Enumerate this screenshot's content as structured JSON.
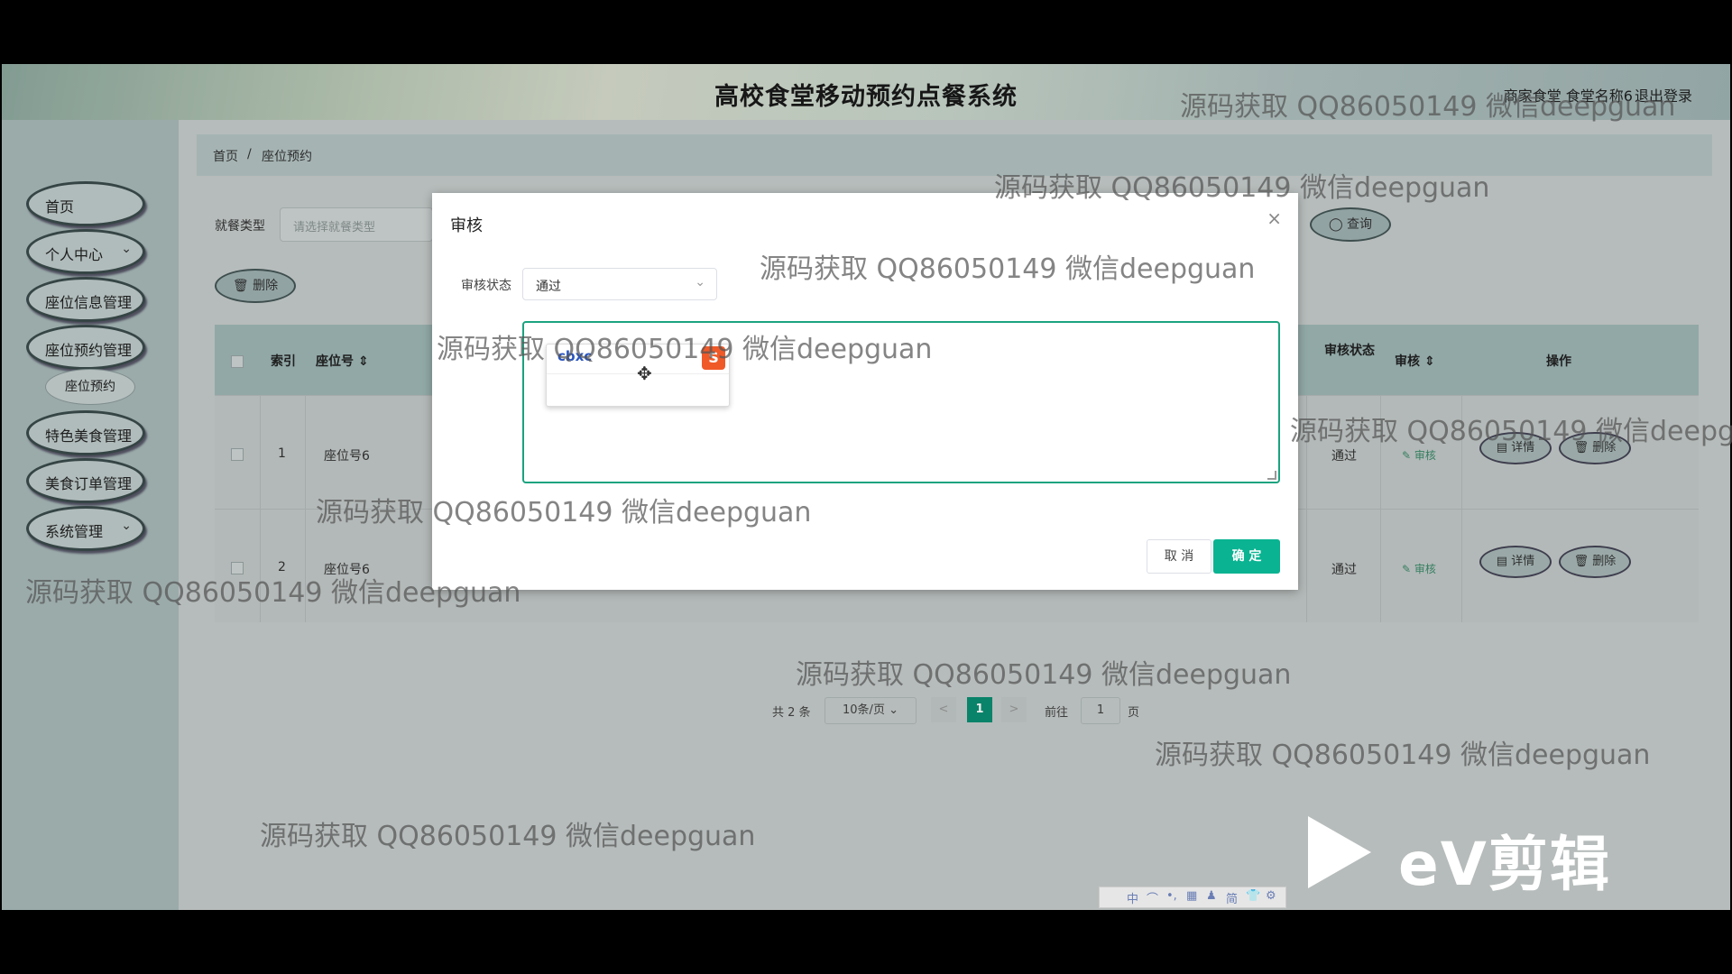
{
  "header": {
    "title": "高校食堂移动预约点餐系统",
    "user": "商家食堂 食堂名称6",
    "logout": "退出登录"
  },
  "sidebar": {
    "items": [
      {
        "label": "首页",
        "chevron": ""
      },
      {
        "label": "个人中心",
        "chevron": "⌄"
      },
      {
        "label": "座位信息管理",
        "chevron": ""
      },
      {
        "label": "座位预约管理",
        "chevron": ""
      },
      {
        "label": "特色美食管理",
        "chevron": ""
      },
      {
        "label": "美食订单管理",
        "chevron": ""
      },
      {
        "label": "系统管理",
        "chevron": "⌄"
      }
    ],
    "sub_item": "座位预约"
  },
  "breadcrumb": {
    "home": "首页",
    "sep": "/",
    "current": "座位预约"
  },
  "filter": {
    "label": "就餐类型",
    "placeholder": "请选择就餐类型",
    "query": "◯ 查询",
    "delete": "🗑 删除"
  },
  "table": {
    "headers": {
      "index": "索引",
      "seat": "座位号 ⇕",
      "audit_status": "审核状态",
      "audit": "审核 ⇕",
      "ops": "操作"
    },
    "rows": [
      {
        "index": "1",
        "seat": "座位号6",
        "status": "通过",
        "audit": "✎ 审核",
        "detail": "▤ 详情",
        "delete": "🗑 删除"
      },
      {
        "index": "2",
        "seat": "座位号6",
        "status": "通过",
        "audit": "✎ 审核",
        "detail": "▤ 详情",
        "delete": "🗑 删除"
      }
    ]
  },
  "pager": {
    "total": "共 2 条",
    "size": "10条/页 ⌄",
    "prev": "<",
    "current": "1",
    "next": ">",
    "goto": "前往",
    "goto_value": "1",
    "page": "页"
  },
  "modal": {
    "title": "审核",
    "close": "×",
    "status_label": "审核状态",
    "status_value": "通过",
    "status_chevron": "⌄",
    "ime_text": "cbxc",
    "ime_logo": "S",
    "ime_move": "✥",
    "cancel": "取 消",
    "ok": "确 定"
  },
  "watermark": "源码获取 QQ86050149 微信deepguan",
  "ime_toolbar": [
    "中",
    "⌒",
    "•,",
    "▦",
    "♟",
    "简",
    "👕",
    "⚙"
  ],
  "ev_logo": "eV剪辑"
}
